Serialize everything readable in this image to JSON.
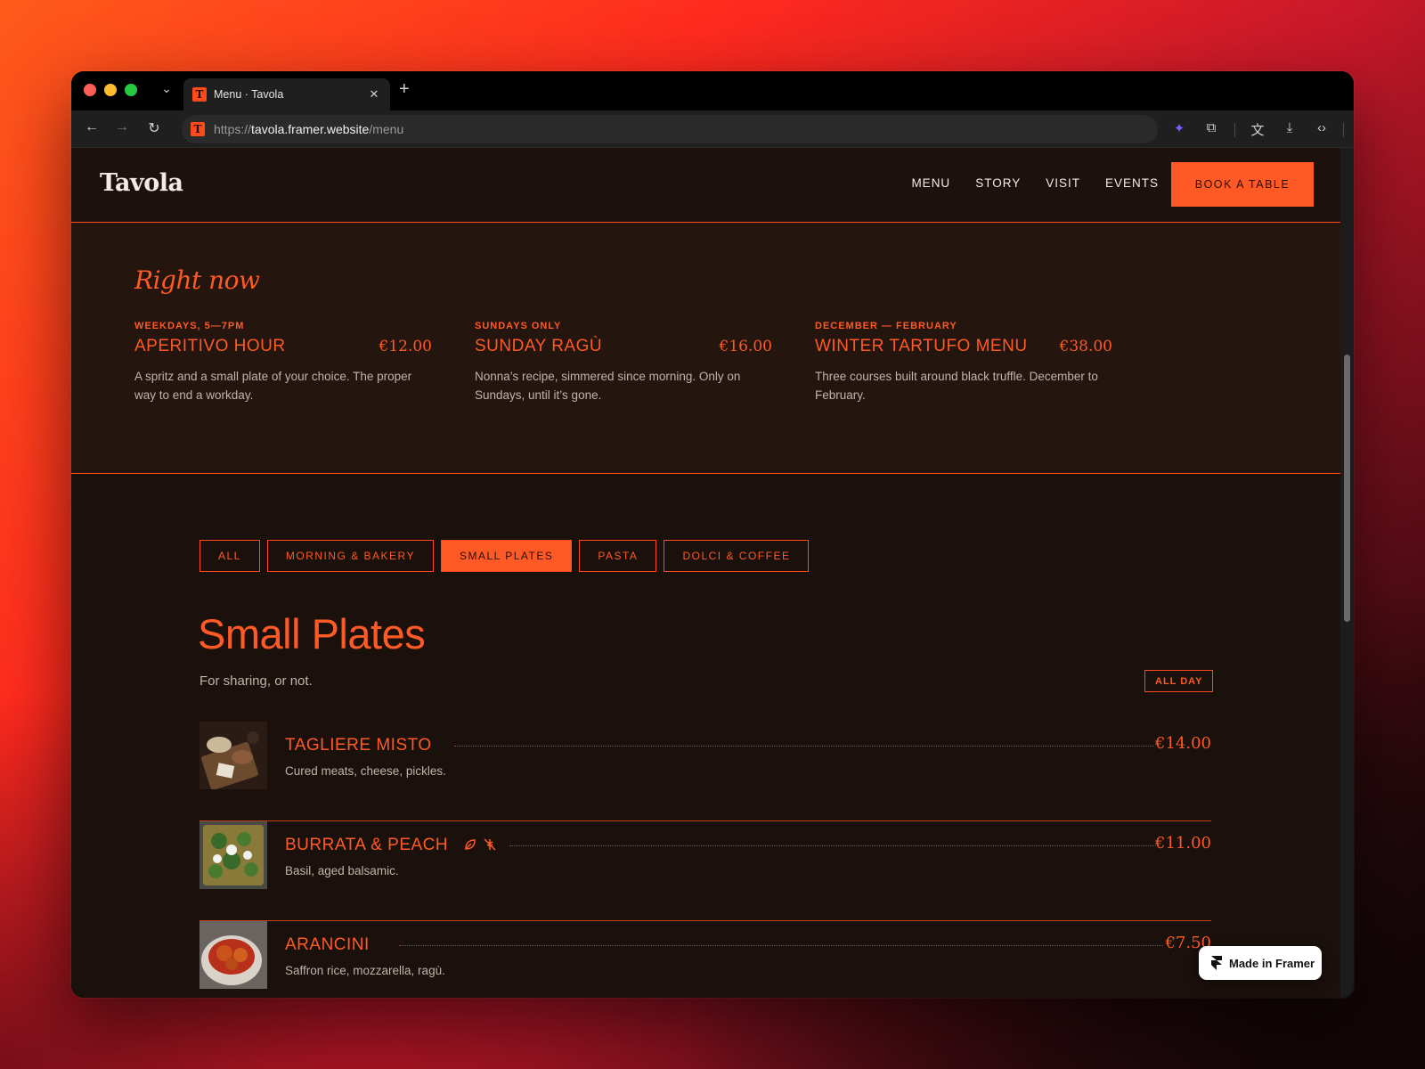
{
  "browser": {
    "tab_title": "Menu · Tavola",
    "favicon_letter": "T",
    "url_scheme": "https://",
    "url_host": "tavola.framer.website",
    "url_path": "/menu"
  },
  "header": {
    "logo": "Tavola",
    "nav": [
      "MENU",
      "STORY",
      "VISIT",
      "EVENTS"
    ],
    "cta": "BOOK A TABLE"
  },
  "right_now": {
    "title": "Right now",
    "specials": [
      {
        "tag": "WEEKDAYS, 5—7PM",
        "name": "APERITIVO HOUR",
        "price": "€12.00",
        "desc": "A spritz and a small plate of your choice. The proper way to end a workday."
      },
      {
        "tag": "SUNDAYS ONLY",
        "name": "SUNDAY RAGÙ",
        "price": "€16.00",
        "desc": "Nonna’s recipe, simmered since morning. Only on Sundays, until it’s gone."
      },
      {
        "tag": "DECEMBER — FEBRUARY",
        "name": "WINTER TARTUFO MENU",
        "price": "€38.00",
        "desc": "Three courses built around black truffle. December to February."
      }
    ]
  },
  "filters": [
    "ALL",
    "MORNING & BAKERY",
    "SMALL PLATES",
    "PASTA",
    "DOLCI & COFFEE"
  ],
  "active_filter": "SMALL PLATES",
  "section": {
    "title": "Small Plates",
    "subtitle": "For sharing, or not.",
    "badge": "ALL DAY",
    "items": [
      {
        "name": "TAGLIERE MISTO",
        "desc": "Cured meats, cheese, pickles.",
        "price": "€14.00"
      },
      {
        "name": "BURRATA & PEACH",
        "desc": "Basil, aged balsamic.",
        "price": "€11.00",
        "icons": [
          "vegetarian-leaf-icon",
          "gluten-free-icon"
        ]
      },
      {
        "name": "ARANCINI",
        "desc": "Saffron rice, mozzarella, ragù.",
        "price": "€7.50"
      }
    ]
  },
  "framer_badge": "Made in Framer",
  "colors": {
    "accent": "#ff5a25",
    "bg": "#1a100c",
    "panel": "#24150f",
    "text_muted": "#bfb5aa"
  }
}
